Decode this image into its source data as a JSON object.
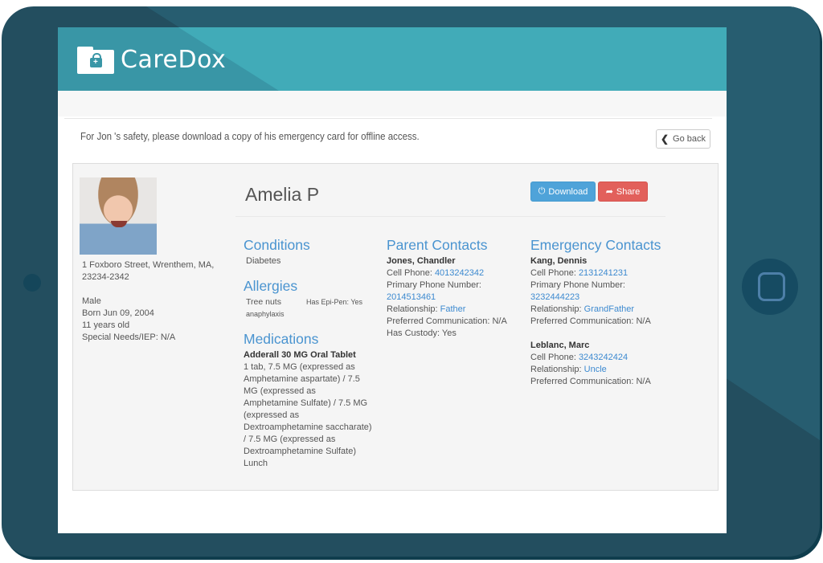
{
  "app": {
    "brand": "CareDox"
  },
  "notice": {
    "text": "For Jon 's safety, please download a copy of his emergency card for offline access.",
    "go_back_label": "Go back"
  },
  "profile": {
    "name": "Amelia P",
    "address_line1": "1 Foxboro Street, Wrenthem, MA,",
    "address_line2": "23234-2342",
    "gender": "Male",
    "born": "Born Jun 09, 2004",
    "age": "11 years old",
    "special_needs": "Special Needs/IEP: N/A"
  },
  "actions": {
    "download_label": "Download",
    "share_label": "Share"
  },
  "conditions": {
    "title": "Conditions",
    "items": [
      "Diabetes"
    ]
  },
  "allergies": {
    "title": "Allergies",
    "items": [
      {
        "name": "Tree nuts",
        "epi_pen": "Has Epi-Pen: Yes",
        "reaction": "anaphylaxis"
      }
    ]
  },
  "medications": {
    "title": "Medications",
    "items": [
      {
        "name": "Adderall 30 MG Oral Tablet",
        "dosage": "1 tab, 7.5 MG (expressed as Amphetamine aspartate) / 7.5 MG (expressed as Amphetamine Sulfate) / 7.5 MG (expressed as Dextroamphetamine saccharate) / 7.5 MG (expressed as Dextroamphetamine Sulfate)",
        "time": "Lunch"
      }
    ]
  },
  "parent_contacts": {
    "title": "Parent Contacts",
    "items": [
      {
        "name": "Jones, Chandler",
        "cell_label": "Cell Phone: ",
        "cell": "4013242342",
        "primary_label": "Primary Phone Number:",
        "primary": "2014513461",
        "relationship_label": "Relationship: ",
        "relationship": "Father",
        "preferred": "Preferred Communication: N/A",
        "custody": "Has Custody: Yes"
      }
    ]
  },
  "emergency_contacts": {
    "title": "Emergency Contacts",
    "items": [
      {
        "name": "Kang, Dennis",
        "cell_label": "Cell Phone: ",
        "cell": "2131241231",
        "primary_label": "Primary Phone Number:",
        "primary": "3232444223",
        "relationship_label": "Relationship: ",
        "relationship": "GrandFather",
        "preferred": "Preferred Communication: N/A"
      },
      {
        "name": "Leblanc, Marc",
        "cell_label": "Cell Phone: ",
        "cell": "3243242424",
        "relationship_label": "Relationship: ",
        "relationship": "Uncle",
        "preferred": "Preferred Communication: N/A"
      }
    ]
  },
  "colors": {
    "header": "#3996a6",
    "header_accent": "#41abb8",
    "frame": "#234e5f",
    "section_title": "#4a94d0",
    "link": "#3d8ad0",
    "download_button": "#4fa3d9",
    "share_button": "#e2605b"
  }
}
